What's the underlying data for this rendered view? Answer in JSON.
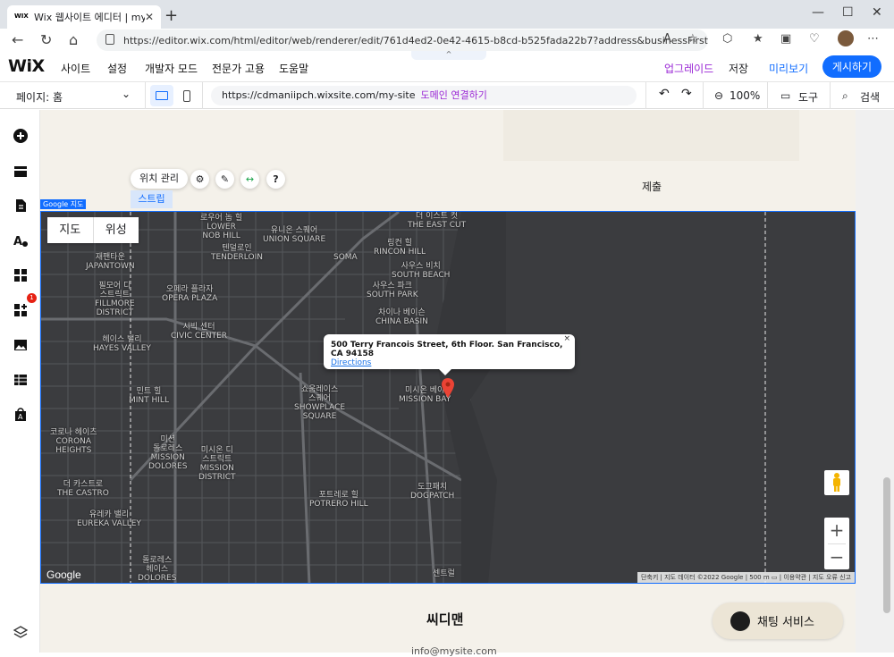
{
  "browser": {
    "tab_title": "Wix 웹사이트 에디터 | my-site",
    "tab_favicon": "WIX",
    "new_tab": "+",
    "url": "https://editor.wix.com/html/editor/web/renderer/edit/761d4ed2-0e42-4615-b8cd-b525fada22b7?address&businessFirstFlow=true...",
    "win_min": "—",
    "win_max": "☐",
    "win_close": "✕"
  },
  "wix_topbar": {
    "logo": "WiX",
    "menu": [
      "사이트",
      "설정",
      "개발자 모드",
      "전문가 고용",
      "도움말"
    ],
    "upgrade": "업그레이드",
    "save": "저장",
    "preview": "미리보기",
    "publish": "게시하기",
    "collapse": "^"
  },
  "subbar": {
    "page_select": "페이지: 홈",
    "site_url": "https://cdmaniipch.wixsite.com/my-site",
    "connect_domain": "도메인 연결하기",
    "zoom": "100%",
    "tools": "도구",
    "search": "검색"
  },
  "left_toolbar": {
    "badge_count": "1"
  },
  "canvas": {
    "submit_label": "제출",
    "manage_location": "위치 관리",
    "strip_label": "스트립",
    "element_name": "Google 지도",
    "brand": "씨디맨",
    "email": "info@mysite.com",
    "chat": "채팅 서비스"
  },
  "map": {
    "type_map": "지도",
    "type_satellite": "위성",
    "address": "500 Terry Francois Street, 6th Floor. San Francisco, CA 94158",
    "directions": "Directions",
    "close": "×",
    "google": "Google",
    "attribution": "단축키 | 지도 데이터 ©2022 Google | 500 m ▭ | 이용약관 | 지도 오류 신고",
    "zoom_in": "+",
    "zoom_out": "−",
    "labels": {
      "union": "유니온 스퀘어\nUNION SQUARE",
      "lower_nob": "로우어 놉 힐\nLOWER\nNOB HILL",
      "tenderloin": "텐덜로인\nTENDERLOIN",
      "japantown": "재팬타운\nJAPANTOWN",
      "fillmore": "필모어 디\n스트릭트\nFILLMORE\nDISTRICT",
      "opera": "오페라 플라자\nOPERA PLAZA",
      "civic": "시빅 센터\nCIVIC CENTER",
      "hayes": "헤이스 밸리\nHAYES VALLEY",
      "soma": "SOMA",
      "rincon": "링컨 힐\nRINCON HILL",
      "south_beach": "사우스 비치\nSOUTH BEACH",
      "south_park": "사우스 파크\nSOUTH PARK",
      "china_basin": "차이나 베이슨\nCHINA BASIN",
      "east_cut": "더 이스트 컷\nTHE EAST CUT",
      "mission_bay": "미시온 베이\nMISSION BAY",
      "mint_hill": "민트 힐\nMINT HILL",
      "showplace": "쇼움레이스\n스퀘어\nSHOWPLACE\nSQUARE",
      "corona": "코로나 헤이츠\nCORONA\nHEIGHTS",
      "mission_dolores": "미션\n돌로레스\nMISSION\nDOLORES",
      "mission_district": "미시온 디\n스트릭트\nMISSION\nDISTRICT",
      "castro": "더 카스트로\nTHE CASTRO",
      "eureka": "유레카 밸리\nEUREKA VALLEY",
      "potrero": "포트레로 힐\nPOTRERO HILL",
      "dogpatch": "도그패치\nDOGPATCH",
      "dolores": "돌로레스\n헤이스\nDOLORES",
      "central": "센트럴"
    }
  }
}
